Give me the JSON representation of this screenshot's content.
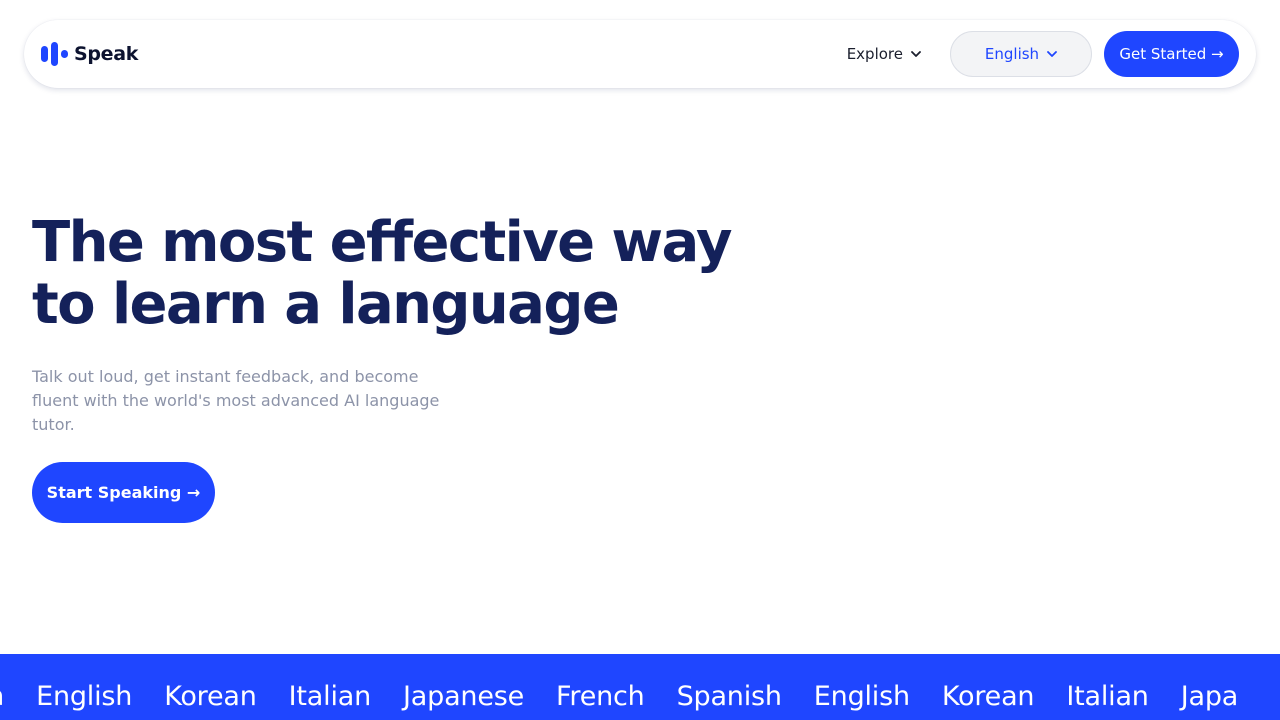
{
  "brand": {
    "name": "Speak",
    "accent": "#1f46ff"
  },
  "nav": {
    "explore_label": "Explore",
    "language_label": "English",
    "get_started_label": "Get Started →"
  },
  "hero": {
    "title": "The most effective way to learn a language",
    "subtitle": "Talk out loud, get instant feedback, and become fluent with the world's most advanced AI language tutor.",
    "cta_label": "Start Speaking →"
  },
  "marquee": {
    "items": [
      "ish",
      "English",
      "Korean",
      "Italian",
      "Japanese",
      "French",
      "Spanish",
      "English",
      "Korean",
      "Italian",
      "Japa"
    ]
  },
  "icons": {
    "logo": "speak-logo-icon",
    "chevron": "chevron-down-icon"
  }
}
